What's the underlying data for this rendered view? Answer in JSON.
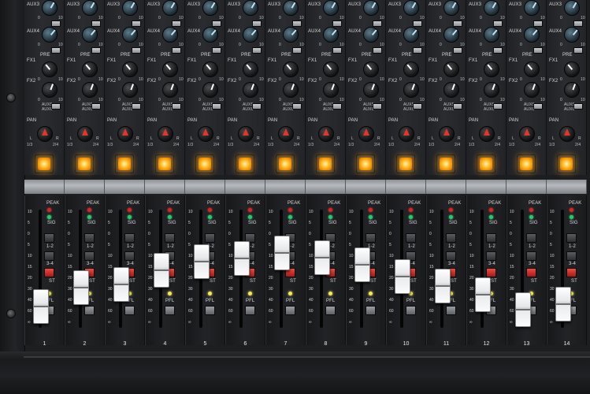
{
  "labels": {
    "aux3": "AUX3",
    "aux4": "AUX4",
    "aux5": "AUX5",
    "aux6": "AUX6",
    "pre": "PRE",
    "fx1": "FX1",
    "fx2": "FX2",
    "pan": "PAN",
    "pan_l": "L",
    "pan_r": "R",
    "pan_13": "1/3",
    "pan_24": "2/4",
    "peak": "PEAK",
    "sig": "SIG",
    "bus12": "1-2",
    "bus34": "3-4",
    "st": "ST",
    "pfl": "PFL",
    "knob_min": "0",
    "knob_max": "10"
  },
  "fader_scale": [
    "10",
    "5",
    "0",
    "5",
    "10",
    "15",
    "20",
    "30",
    "40",
    "60",
    "∞"
  ],
  "channels": [
    {
      "number": "1",
      "fader_level": 0.08
    },
    {
      "number": "2",
      "fader_level": 0.3
    },
    {
      "number": "3",
      "fader_level": 0.34
    },
    {
      "number": "4",
      "fader_level": 0.5
    },
    {
      "number": "5",
      "fader_level": 0.6
    },
    {
      "number": "6",
      "fader_level": 0.64
    },
    {
      "number": "7",
      "fader_level": 0.7
    },
    {
      "number": "8",
      "fader_level": 0.65
    },
    {
      "number": "9",
      "fader_level": 0.56
    },
    {
      "number": "10",
      "fader_level": 0.43
    },
    {
      "number": "11",
      "fader_level": 0.32
    },
    {
      "number": "12",
      "fader_level": 0.22
    },
    {
      "number": "13",
      "fader_level": 0.05
    },
    {
      "number": "14",
      "fader_level": 0.11
    }
  ],
  "colors": {
    "mute_glow": "#ffa51f",
    "pan_pointer": "#e8332a",
    "aux_knob": "#5d7a8a",
    "peak_led": "#dd2222",
    "sig_led": "#22cc66",
    "st_button": "#e0342a",
    "fader_cap": "#f2f2f4"
  }
}
